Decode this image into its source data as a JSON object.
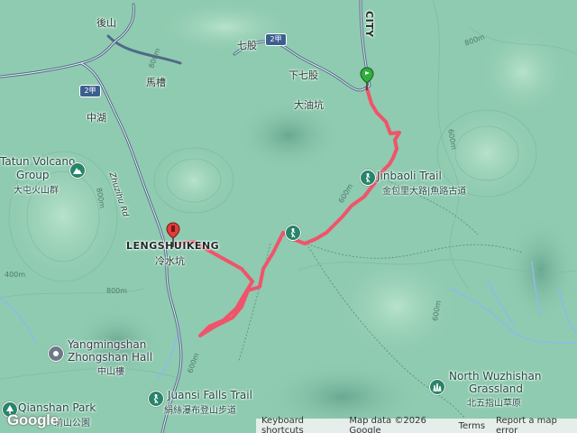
{
  "map": {
    "place_labels": {
      "houshan": "後山",
      "qigu": "七股",
      "xiaqigu": "下七股",
      "macao": "馬槽",
      "dayoukeng": "大油坑",
      "zhonghu": "中湖",
      "city": "CITY",
      "lengshuikeng_en": "LENGSHUIKENG",
      "lengshuikeng_zh": "冷水坑"
    },
    "road_labels": {
      "zhuzihu_rd": "Zhuzihu Rd",
      "shield_2jia": "2甲"
    },
    "pois": {
      "datun_en_1": "Tatun Volcano",
      "datun_en_2": "Group",
      "datun_zh": "大屯火山群",
      "jinbaoli_en": "Jinbaoli Trail",
      "jinbaoli_zh": "金包里大路|魚路古道",
      "zhongshan_en_1": "Yangmingshan",
      "zhongshan_en_2": "Zhongshan Hall",
      "zhongshan_zh": "中山樓",
      "juansi_en": "Juansi Falls Trail",
      "juansi_zh": "絹絲瀑布登山步道",
      "qianshan_en": "Qianshan Park",
      "qianshan_zh": "前山公園",
      "wuzhishan_en_1": "North Wuzhishan",
      "wuzhishan_en_2": "Grassland",
      "wuzhishan_zh": "北五指山草原"
    },
    "contour_labels": [
      "800m",
      "800m",
      "600m",
      "600m",
      "800m",
      "600m",
      "400m",
      "600m",
      "800m"
    ],
    "route_color": "#f0546a",
    "start_marker_color": "#2fae3c",
    "end_marker_color": "#e13c3c"
  },
  "attribution": {
    "logo": "Google",
    "keyboard": "Keyboard shortcuts",
    "mapdata": "Map data ©2026 Google",
    "terms": "Terms",
    "report": "Report a map error"
  }
}
